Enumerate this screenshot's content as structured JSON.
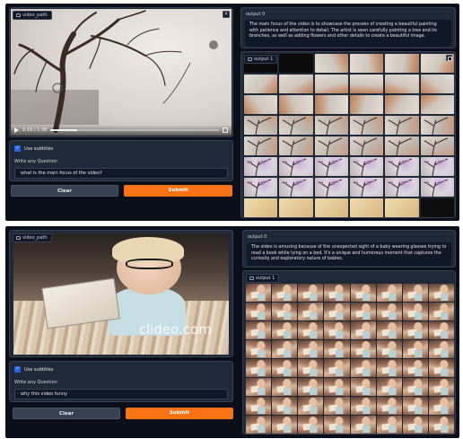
{
  "panel1": {
    "input": {
      "tag": "video_path",
      "time": "0:16 / 1:38",
      "progress_pct": 16,
      "use_subtitles_label": "Use subtitles",
      "use_subtitles_checked": true,
      "question_label": "Write any Question",
      "question_value": "what is the main focus of the video?",
      "clear_label": "Clear",
      "submit_label": "Submit"
    },
    "output": {
      "text_label": "output 0",
      "text": "The main focus of the video is to showcase the process of creating a beautiful painting with patience and attention to detail. The artist is seen carefully painting a tree and its branches, as well as adding flowers and other details to create a beautiful image.",
      "gallery_label": "output 1"
    }
  },
  "panel2": {
    "input": {
      "tag": "video_path",
      "watermark": "clideo.com",
      "use_subtitles_label": "Use subtitles",
      "use_subtitles_checked": true,
      "question_label": "Write any Question",
      "question_value": "why this video funny",
      "clear_label": "Clear",
      "submit_label": "Submit"
    },
    "output": {
      "text_label": "output 0",
      "text": "The video is amusing because of the unexpected sight of a baby wearing glasses trying to read a book while lying on a bed. It's a unique and humorous moment that captures the curiosity and exploratory nature of babies.",
      "gallery_label": "output 1"
    }
  },
  "colors": {
    "background": "#0b0f19",
    "block": "#1f2937",
    "accent": "#f97316",
    "checkbox": "#2563eb"
  }
}
